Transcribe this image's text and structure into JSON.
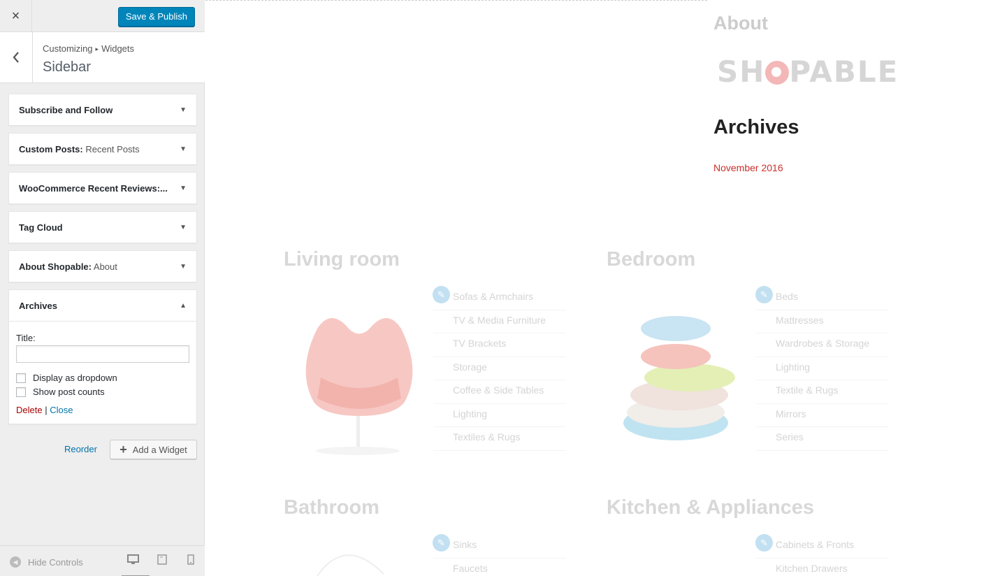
{
  "header": {
    "close_icon": "×",
    "save_label": "Save & Publish"
  },
  "section": {
    "breadcrumb_1": "Customizing",
    "breadcrumb_sep": "▸",
    "breadcrumb_2": "Widgets",
    "title": "Sidebar"
  },
  "widgets": [
    {
      "title": "Subscribe and Follow",
      "sub": ""
    },
    {
      "title": "Custom Posts:",
      "sub": " Recent Posts"
    },
    {
      "title": "WooCommerce Recent Reviews:...",
      "sub": ""
    },
    {
      "title": "Tag Cloud",
      "sub": ""
    },
    {
      "title": "About Shopable:",
      "sub": " About"
    },
    {
      "title": "Archives",
      "sub": ""
    }
  ],
  "archives_form": {
    "title_label": "Title:",
    "title_value": "",
    "dropdown_label": "Display as dropdown",
    "counts_label": "Show post counts",
    "delete_label": "Delete",
    "separator": " | ",
    "close_label": "Close"
  },
  "footer_actions": {
    "reorder_label": "Reorder",
    "add_widget_label": "Add a Widget"
  },
  "footer": {
    "hide_controls_label": "Hide Controls"
  },
  "preview": {
    "about_title": "About",
    "logo_text_1": "SH",
    "logo_text_2": "PABLE",
    "archives_title": "Archives",
    "archive_link": "November 2016",
    "living_room": {
      "title": "Living room",
      "items": [
        "Sofas & Armchairs",
        "TV & Media Furniture",
        "TV Brackets",
        "Storage",
        "Coffee & Side Tables",
        "Lighting",
        "Textiles & Rugs"
      ]
    },
    "bedroom": {
      "title": "Bedroom",
      "items": [
        "Beds",
        "Mattresses",
        "Wardrobes & Storage",
        "Lighting",
        "Textile & Rugs",
        "Mirrors",
        "Series"
      ]
    },
    "bathroom": {
      "title": "Bathroom",
      "items": [
        "Sinks",
        "Faucets"
      ]
    },
    "kitchen": {
      "title": "Kitchen & Appliances",
      "items": [
        "Cabinets & Fronts",
        "Kitchen Drawers"
      ]
    }
  },
  "colors": {
    "primary_button": "#0085ba",
    "link": "#0073aa",
    "delete": "#a00",
    "archive_link": "#c9302c"
  }
}
